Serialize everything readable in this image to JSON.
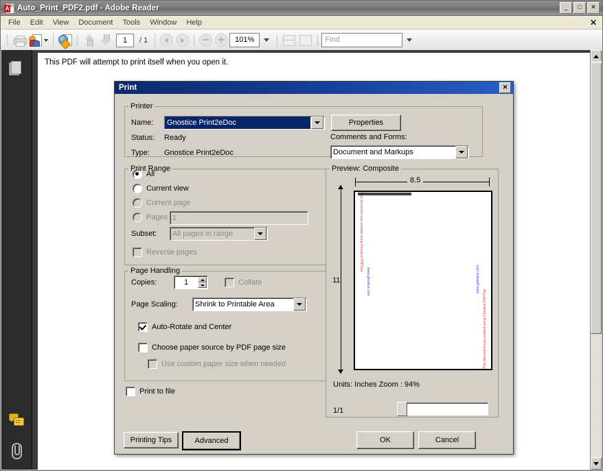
{
  "window": {
    "title": "Auto_Print_PDF2.pdf - Adobe Reader",
    "app_icon": "pdf-document-icon",
    "minimize": "_",
    "maximize": "□",
    "close": "✕"
  },
  "menu": {
    "items": [
      "File",
      "Edit",
      "View",
      "Document",
      "Tools",
      "Window",
      "Help"
    ],
    "close_document": "✕"
  },
  "toolbar": {
    "print_icon": "printer-icon",
    "collaborate_icon": "collaborate-icon",
    "attach_web_icon": "globe-document-icon",
    "prev_page_icon": "arrow-up-icon",
    "next_page_icon": "arrow-down-icon",
    "page_number": "1",
    "page_separator": "/",
    "page_total": "1",
    "back_icon": "previous-view-icon",
    "forward_icon": "next-view-icon",
    "zoom_out_icon": "zoom-out-icon",
    "zoom_in_icon": "zoom-in-icon",
    "zoom_value": "101%",
    "fit_width_icon": "fit-width-icon",
    "fit_page_icon": "fit-page-icon",
    "find_placeholder": "Find"
  },
  "navpane": {
    "pages_icon": "pages-panel-icon",
    "comments_icon": "comments-panel-icon",
    "attachments_icon": "attachments-panel-icon"
  },
  "document": {
    "body_text": "This PDF will attempt to print itself when you open it."
  },
  "dialog": {
    "title": "Print",
    "close_label": "✕",
    "printer": {
      "legend": "Printer",
      "name_label": "Name:",
      "name_value": "Gnostice Print2eDoc",
      "properties_button": "Properties",
      "status_label": "Status:",
      "status_value": "Ready",
      "type_label": "Type:",
      "type_value": "Gnostice Print2eDoc",
      "comments_label": "Comments and Forms:",
      "comments_value": "Document and Markups"
    },
    "print_range": {
      "legend": "Print Range",
      "all": "All",
      "current_view": "Current view",
      "current_page": "Current page",
      "pages": "Pages",
      "pages_value": "1",
      "subset_label": "Subset:",
      "subset_value": "All pages in range",
      "reverse_pages": "Reverse pages",
      "selected": "All"
    },
    "page_handling": {
      "legend": "Page Handling",
      "copies_label": "Copies:",
      "copies_value": "1",
      "collate": "Collate",
      "page_scaling_label": "Page Scaling:",
      "page_scaling_value": "Shrink to Printable Area",
      "auto_rotate": "Auto-Rotate and Center",
      "auto_rotate_checked": true,
      "choose_paper_source": "Choose paper source by PDF page size",
      "use_custom_paper": "Use custom paper size when needed"
    },
    "print_to_file": "Print to file",
    "preview": {
      "legend": "Preview: Composite",
      "width_label": "8.5",
      "height_label": "11",
      "units_text": "Units: Inches Zoom :  94%",
      "page_counter": "1/1",
      "watermark_red": "This document was created using Gnostice PDFOne",
      "watermark_blue": "www.gnostice.com",
      "watermark_red_color": "#d94040",
      "watermark_blue_color": "#3a3ad0"
    },
    "buttons": {
      "printing_tips": "Printing Tips",
      "advanced": "Advanced",
      "ok": "OK",
      "cancel": "Cancel"
    }
  },
  "colors": {
    "dialog_title_start": "#0c2a6b",
    "dialog_title_end": "#2a5fc4",
    "dialog_face": "#d4d0c8",
    "selection": "#0a246a"
  }
}
